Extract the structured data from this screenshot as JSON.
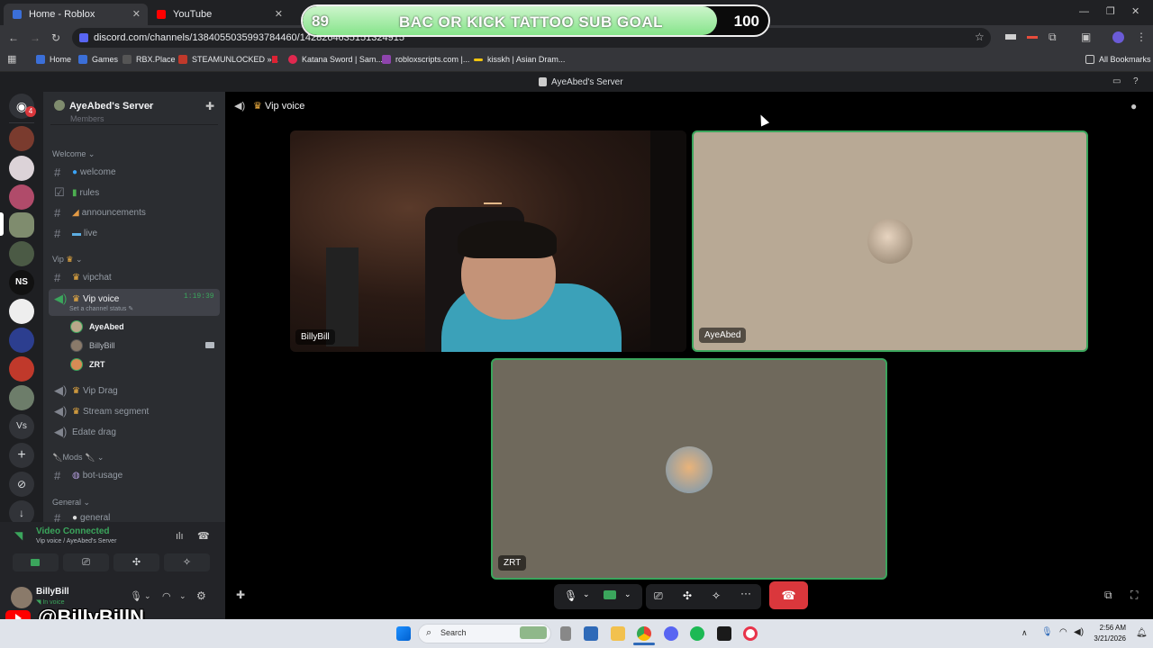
{
  "browser": {
    "tabs": [
      {
        "title": "Home - Roblox"
      },
      {
        "title": "YouTube"
      }
    ],
    "url": "discord.com/channels/1384055035993784460/1428264635151324915",
    "bookmarks": [
      "Home",
      "Games",
      "RBX.Place",
      "STEAMUNLOCKED »...",
      "Katana Sword | Sam...",
      "robloxscripts.com |...",
      "kisskh | Asian Dram...",
      "All Bookmarks"
    ]
  },
  "overlay": {
    "left_value": "89",
    "title": "BAC OR KICK TATTOO SUB GOAL",
    "right_value": "100",
    "progress": 0.89,
    "watermark": "@BillyBillN"
  },
  "discord": {
    "window_title": "AyeAbed's Server",
    "server_name": "AyeAbed's Server",
    "voice_header": "Vip voice",
    "server_badge": "4",
    "server_label_ns": "NS",
    "server_label_vs": "Vs",
    "partial_top": "Members",
    "categories": {
      "welcome": "Welcome",
      "vip": "Vip",
      "mods": "Mods",
      "general": "General"
    },
    "channels": {
      "welcome": "welcome",
      "rules": "rules",
      "announcements": "announcements",
      "live": "live",
      "vipchat": "vipchat",
      "vip_voice": "Vip voice",
      "vip_voice_time": "1:19:39",
      "set_status": "Set a channel status",
      "vip_drag": "Vip Drag",
      "stream_segment": "Stream segment",
      "edate_drag": "Edate drag",
      "bot_usage": "bot-usage",
      "general_partial": "general"
    },
    "voice_users": [
      "AyeAbed",
      "BillyBill",
      "ZRT"
    ],
    "connection": {
      "status": "Video Connected",
      "location": "Vip voice / AyeAbed's Server"
    },
    "user": {
      "name": "BillyBill",
      "status": "In voice"
    },
    "tiles": [
      "BillyBill",
      "AyeAbed",
      "ZRT"
    ],
    "colors": {
      "accent": "#3ba55c",
      "danger": "#da373c"
    }
  },
  "taskbar": {
    "search_placeholder": "Search",
    "time": "2:56 AM",
    "date": "3/21/2026"
  }
}
